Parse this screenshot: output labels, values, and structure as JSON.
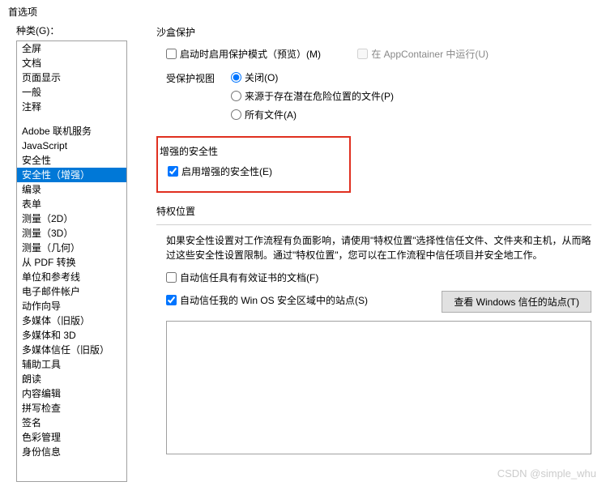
{
  "window": {
    "title": "首选项"
  },
  "sidebar": {
    "label": "种类(G)：",
    "group1": [
      "全屏",
      "文档",
      "页面显示",
      "一般",
      "注释"
    ],
    "group2": [
      "Adobe 联机服务",
      "JavaScript",
      "安全性",
      "安全性（增强）",
      "编录",
      "表单",
      "测量（2D）",
      "测量（3D）",
      "测量（几何）",
      "从 PDF 转换",
      "单位和参考线",
      "电子邮件帐户",
      "动作向导",
      "多媒体（旧版）",
      "多媒体和 3D",
      "多媒体信任（旧版）",
      "辅助工具",
      "朗读",
      "内容编辑",
      "拼写检查",
      "签名",
      "色彩管理",
      "身份信息"
    ],
    "selectedIndex": 3
  },
  "sandbox": {
    "title": "沙盒保护",
    "enableProtectedMode": "启动时启用保护模式（预览）(M)",
    "runInAppContainer": "在 AppContainer 中运行(U)",
    "protectedViewLabel": "受保护视图",
    "options": {
      "off": "关闭(O)",
      "risky": "来源于存在潜在危险位置的文件(P)",
      "all": "所有文件(A)"
    }
  },
  "enhanced": {
    "title": "增强的安全性",
    "enable": "启用增强的安全性(E)"
  },
  "privileged": {
    "title": "特权位置",
    "desc": "如果安全性设置对工作流程有负面影响，请使用\"特权位置\"选择性信任文件、文件夹和主机，从而略过这些安全性设置限制。通过\"特权位置\"，您可以在工作流程中信任项目并安全地工作。",
    "autoTrustCert": "自动信任具有有效证书的文档(F)",
    "autoTrustWin": "自动信任我的 Win OS 安全区域中的站点(S)",
    "viewWinSites": "查看 Windows 信任的站点(T)"
  },
  "watermark": "CSDN @simple_whu"
}
